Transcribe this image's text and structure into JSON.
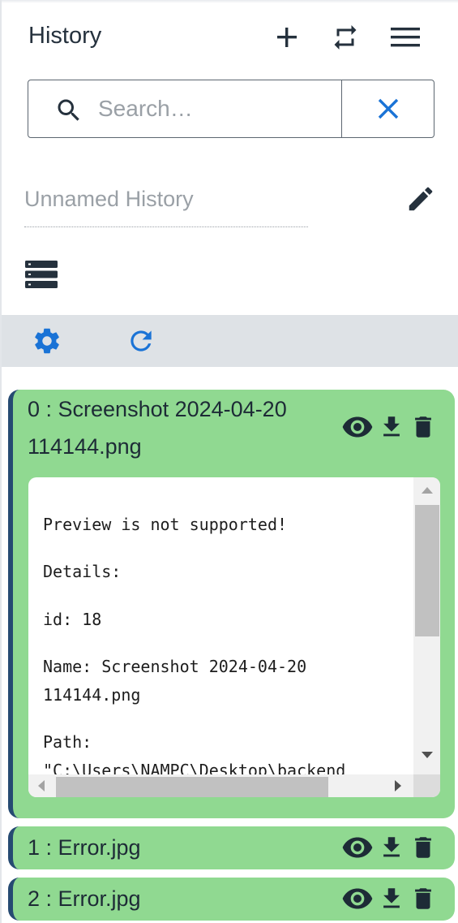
{
  "header": {
    "title": "History",
    "icons": [
      "plus-icon",
      "switch-icon",
      "menu-icon"
    ]
  },
  "search": {
    "placeholder": "Search…",
    "value": ""
  },
  "history_name": {
    "placeholder": "Unnamed History"
  },
  "toolbar": {
    "icons": [
      "gear-icon",
      "refresh-icon"
    ]
  },
  "colors": {
    "accent": "#1a73d6",
    "dark": "#25313d",
    "item_bg": "#90d991",
    "item_border": "#264a72",
    "toolbar_bg": "#dee2e6"
  },
  "items": [
    {
      "title_line1": "0 : Screenshot 2024-04-20",
      "title_line2": "114144.png",
      "expanded": true,
      "preview_lines": [
        "Preview is not supported!",
        "Details:",
        "id: 18",
        "Name: Screenshot 2024-04-20",
        "114144.png",
        "Path:",
        "\"C:\\Users\\NAMPC\\Desktop\\backend"
      ]
    },
    {
      "title": "1 : Error.jpg",
      "expanded": false
    },
    {
      "title": "2 : Error.jpg",
      "expanded": false
    }
  ]
}
